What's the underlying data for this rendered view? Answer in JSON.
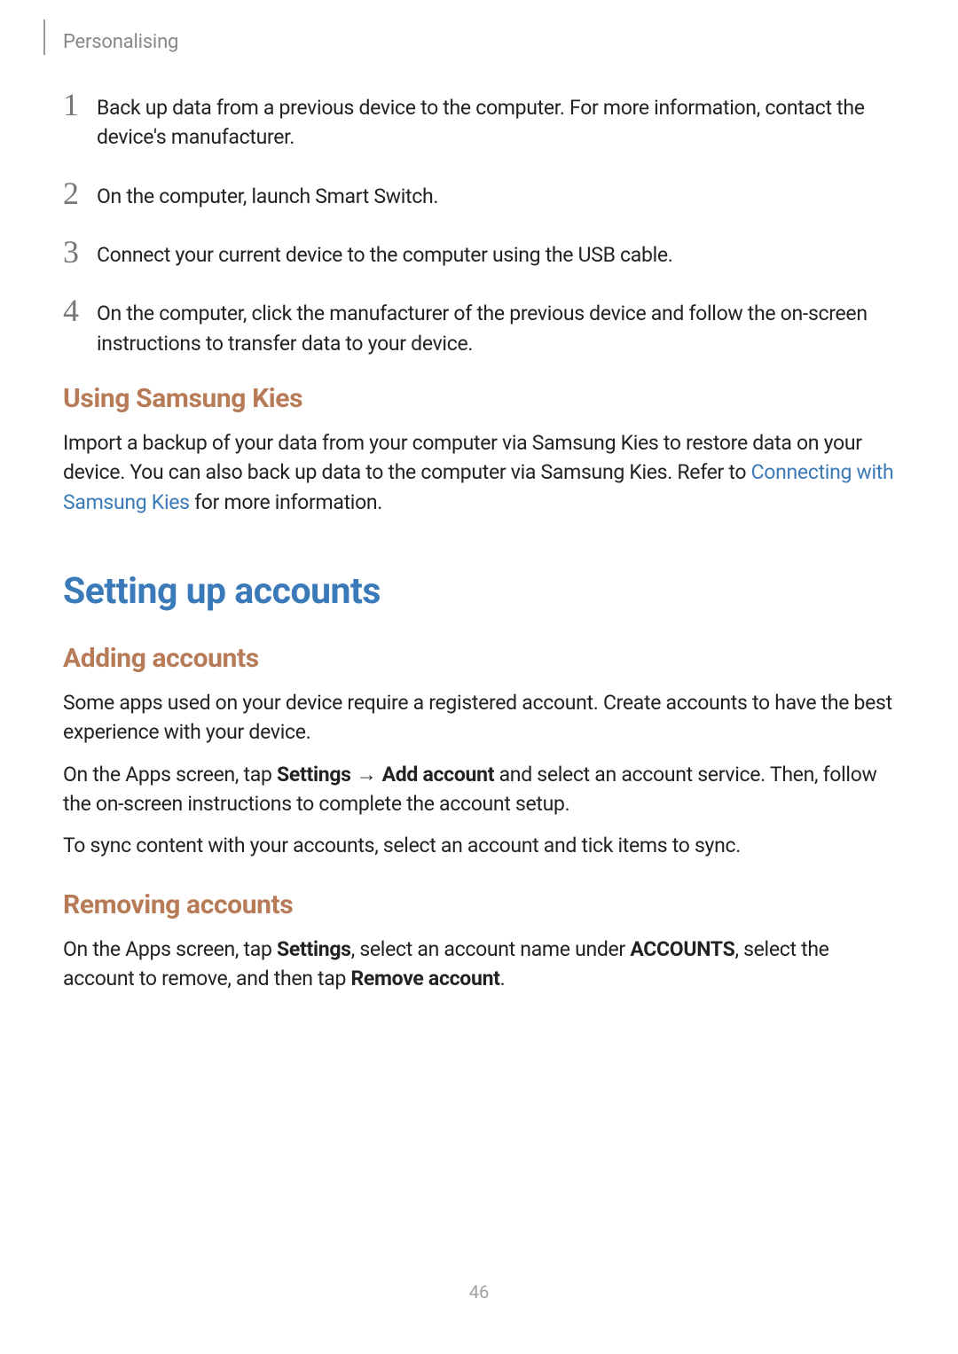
{
  "header": "Personalising",
  "steps": [
    {
      "num": "1",
      "text": "Back up data from a previous device to the computer. For more information, contact the device's manufacturer."
    },
    {
      "num": "2",
      "text": "On the computer, launch Smart Switch."
    },
    {
      "num": "3",
      "text": "Connect your current device to the computer using the USB cable."
    },
    {
      "num": "4",
      "text": "On the computer, click the manufacturer of the previous device and follow the on-screen instructions to transfer data to your device."
    }
  ],
  "kies": {
    "heading": "Using Samsung Kies",
    "text_before_link": "Import a backup of your data from your computer via Samsung Kies to restore data on your device. You can also back up data to the computer via Samsung Kies. Refer to ",
    "link_text": "Connecting with Samsung Kies",
    "text_after_link": " for more information."
  },
  "accounts": {
    "main_heading": "Setting up accounts",
    "adding": {
      "heading": "Adding accounts",
      "p1": "Some apps used on your device require a registered account. Create accounts to have the best experience with your device.",
      "p2_prefix": "On the Apps screen, tap ",
      "p2_bold1": "Settings",
      "p2_arrow": " → ",
      "p2_bold2": "Add account",
      "p2_suffix": " and select an account service. Then, follow the on-screen instructions to complete the account setup.",
      "p3": "To sync content with your accounts, select an account and tick items to sync."
    },
    "removing": {
      "heading": "Removing accounts",
      "p1_prefix": "On the Apps screen, tap ",
      "p1_bold1": "Settings",
      "p1_mid1": ", select an account name under ",
      "p1_bold2": "ACCOUNTS",
      "p1_mid2": ", select the account to remove, and then tap ",
      "p1_bold3": "Remove account",
      "p1_suffix": "."
    }
  },
  "page_number": "46"
}
